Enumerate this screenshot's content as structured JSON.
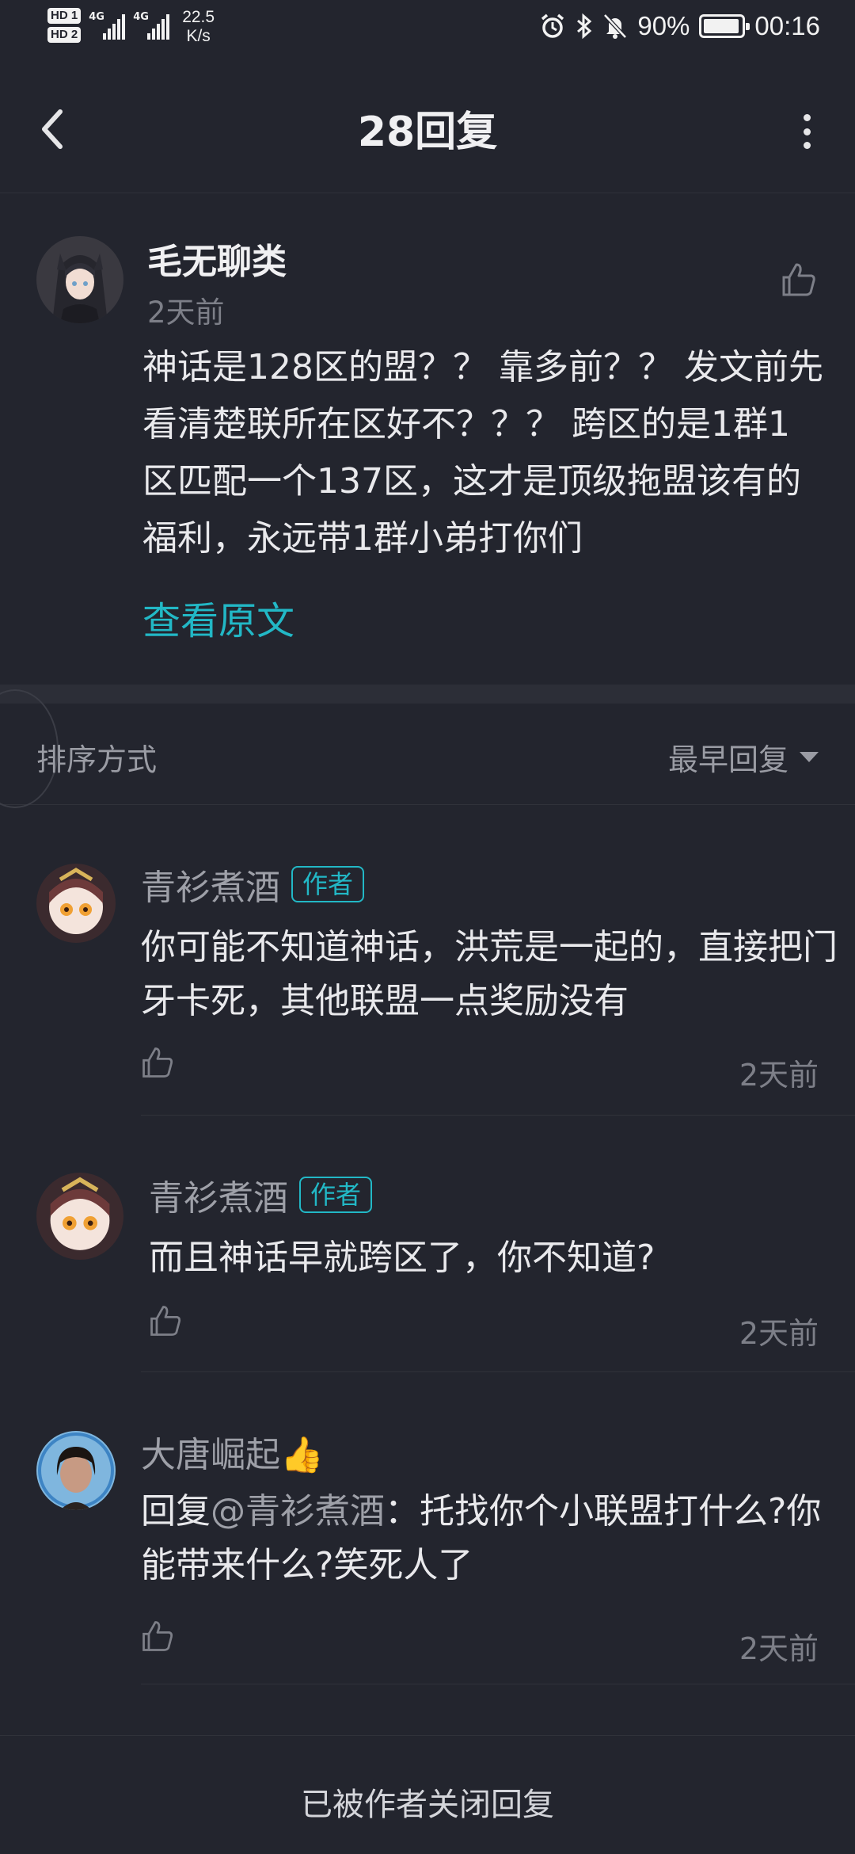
{
  "status_bar": {
    "hd1": "HD 1",
    "hd2": "HD 2",
    "net1": "4G",
    "net2": "4G",
    "speed_value": "22.5",
    "speed_unit": "K/s",
    "battery": "90%",
    "time": "00:16"
  },
  "nav": {
    "title": "28回复"
  },
  "post": {
    "author": "毛无聊类",
    "time": "2天前",
    "body": "神话是128区的盟？？ 靠多前？？ 发文前先看清楚联所在区好不？？？ 跨区的是1群1区匹配一个137区，这才是顶级拖盟该有的福利，永远带1群小弟打你们",
    "view_original": "查看原文"
  },
  "sort": {
    "label": "排序方式",
    "selected": "最早回复"
  },
  "replies": [
    {
      "name": "青衫煮酒",
      "badge": "作者",
      "body": "你可能不知道神话，洪荒是一起的，直接把门牙卡死，其他联盟一点奖励没有",
      "time": "2天前"
    },
    {
      "name": "青衫煮酒",
      "badge": "作者",
      "body": "而且神话早就跨区了，你不知道?",
      "time": "2天前"
    },
    {
      "name": "大唐崛起👍",
      "reply_prefix": "回复",
      "mention": "@青衫煮酒",
      "body": "：托找你个小联盟打什么?你能带来什么?笑死人了",
      "time": "2天前"
    }
  ],
  "footer": {
    "text": "已被作者关闭回复"
  }
}
